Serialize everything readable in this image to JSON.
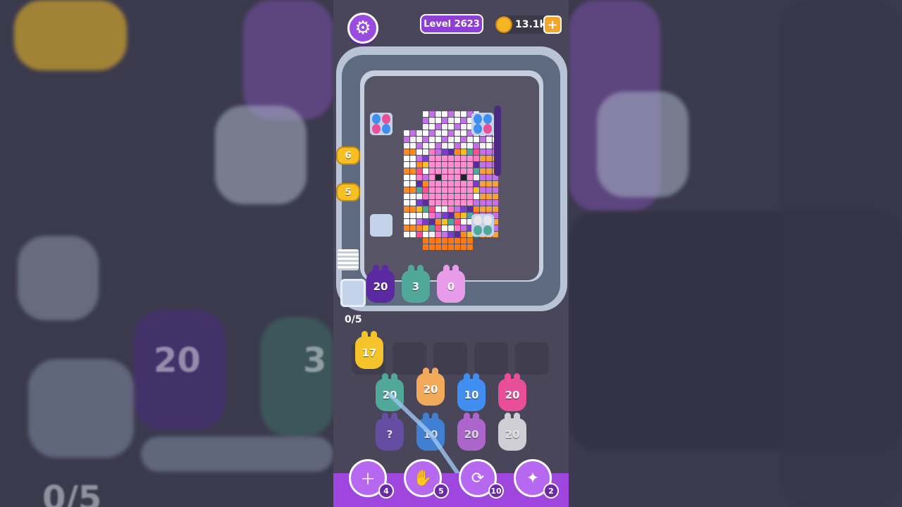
{
  "header": {
    "level_label": "Level 2623",
    "coins": "13.1k",
    "plus_label": "+"
  },
  "hooks": [
    {
      "value": "6"
    },
    {
      "value": "5"
    }
  ],
  "queue_counter": "0/5",
  "conveyor_bunnies": [
    {
      "value": "20",
      "color": "#5b2aa3"
    },
    {
      "value": "3",
      "color": "#4fa898"
    },
    {
      "value": "0",
      "color": "#e79be8"
    }
  ],
  "holding_bunny": {
    "value": "17",
    "color": "#f5c32a"
  },
  "grid_bunnies": [
    {
      "value": "20",
      "color": "#4fa898"
    },
    {
      "value": "20",
      "color": "#f3a95a"
    },
    {
      "value": "10",
      "color": "#3f8ef0"
    },
    {
      "value": "20",
      "color": "#e94f98"
    },
    {
      "value": "?",
      "color": "#6b4fb0"
    },
    {
      "value": "10",
      "color": "#3f8ef0"
    },
    {
      "value": "20",
      "color": "#c56fe8"
    },
    {
      "value": "20",
      "color": "#e6e6ea"
    }
  ],
  "tools": [
    {
      "icon": "add-card-icon",
      "glyph": "＋",
      "count": "4"
    },
    {
      "icon": "hand-icon",
      "glyph": "✋",
      "count": "5"
    },
    {
      "icon": "shuffle-icon",
      "glyph": "⟳",
      "count": "10"
    },
    {
      "icon": "magic-bunny-icon",
      "glyph": "✦",
      "count": "2"
    }
  ],
  "background_left_label": "20",
  "background_left_label2": "3",
  "background_bottom_label": "0/5",
  "colors": {
    "accent": "#9a4ce0",
    "track": "#b8c4d6",
    "coin": "#f6b623"
  }
}
